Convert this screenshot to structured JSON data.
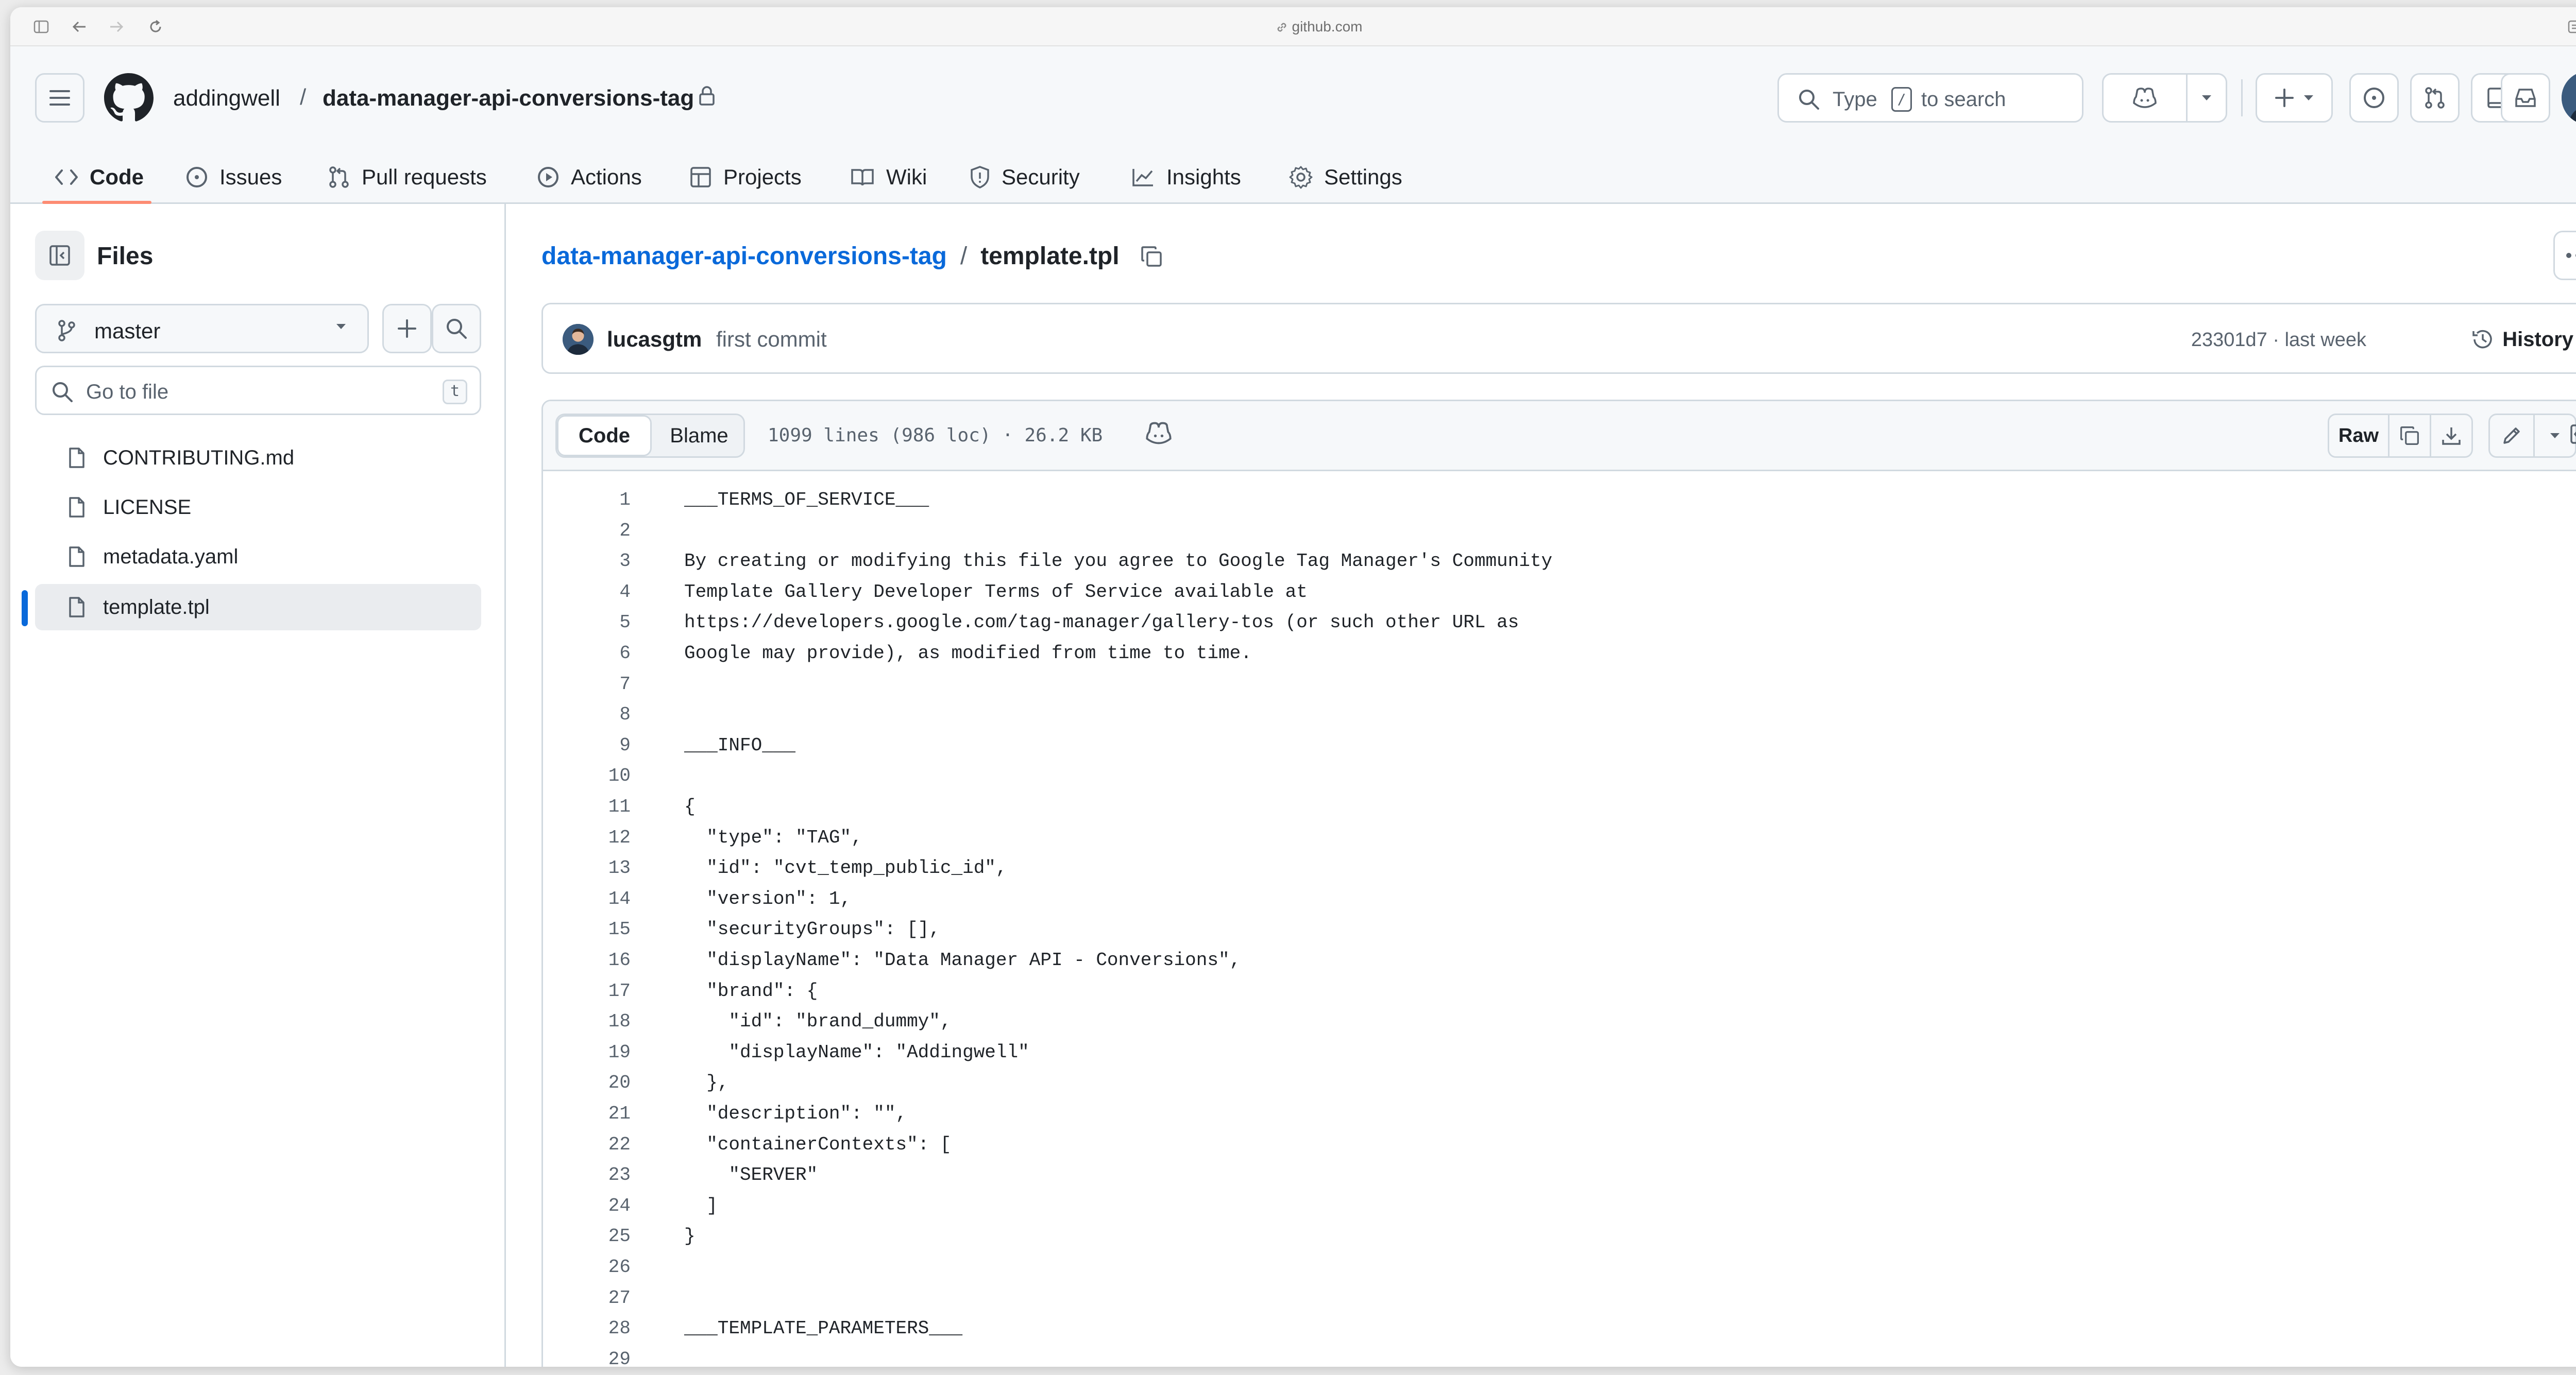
{
  "browser": {
    "url": "github.com"
  },
  "header": {
    "owner": "addingwell",
    "separator": "/",
    "repo": "data-manager-api-conversions-tag",
    "search": {
      "prefix": "Type",
      "key": "/",
      "suffix": "to search"
    }
  },
  "tabs": [
    {
      "label": "Code",
      "icon": "code-icon",
      "active": true
    },
    {
      "label": "Issues",
      "icon": "issue-opened-icon"
    },
    {
      "label": "Pull requests",
      "icon": "git-pull-request-icon"
    },
    {
      "label": "Actions",
      "icon": "play-icon"
    },
    {
      "label": "Projects",
      "icon": "table-icon"
    },
    {
      "label": "Wiki",
      "icon": "book-icon"
    },
    {
      "label": "Security",
      "icon": "shield-icon"
    },
    {
      "label": "Insights",
      "icon": "graph-icon"
    },
    {
      "label": "Settings",
      "icon": "gear-icon"
    }
  ],
  "sidebar": {
    "title": "Files",
    "branch": "master",
    "goto_placeholder": "Go to file",
    "goto_key": "t",
    "files": [
      {
        "name": "CONTRIBUTING.md"
      },
      {
        "name": "LICENSE"
      },
      {
        "name": "metadata.yaml"
      },
      {
        "name": "template.tpl",
        "selected": true
      }
    ]
  },
  "breadcrumb": {
    "repo": "data-manager-api-conversions-tag",
    "separator": "/",
    "file": "template.tpl"
  },
  "commit": {
    "author": "lucasgtm",
    "message": "first commit",
    "hash_time": "23301d7 · last week",
    "history_label": "History"
  },
  "fileview": {
    "code_tab": "Code",
    "blame_tab": "Blame",
    "meta": "1099 lines (986 loc) · 26.2 KB",
    "raw_label": "Raw"
  },
  "code_lines": [
    "___TERMS_OF_SERVICE___",
    "",
    "By creating or modifying this file you agree to Google Tag Manager's Community",
    "Template Gallery Developer Terms of Service available at",
    "https://developers.google.com/tag-manager/gallery-tos (or such other URL as",
    "Google may provide), as modified from time to time.",
    "",
    "",
    "___INFO___",
    "",
    "{",
    "  \"type\": \"TAG\",",
    "  \"id\": \"cvt_temp_public_id\",",
    "  \"version\": 1,",
    "  \"securityGroups\": [],",
    "  \"displayName\": \"Data Manager API - Conversions\",",
    "  \"brand\": {",
    "    \"id\": \"brand_dummy\",",
    "    \"displayName\": \"Addingwell\"",
    "  },",
    "  \"description\": \"\",",
    "  \"containerContexts\": [",
    "    \"SERVER\"",
    "  ]",
    "}",
    "",
    "",
    "___TEMPLATE_PARAMETERS___",
    ""
  ],
  "colors": {
    "accent": "#0969da",
    "tab_underline": "#fd8c73",
    "border": "#d1d9e0",
    "muted": "#59636e"
  }
}
